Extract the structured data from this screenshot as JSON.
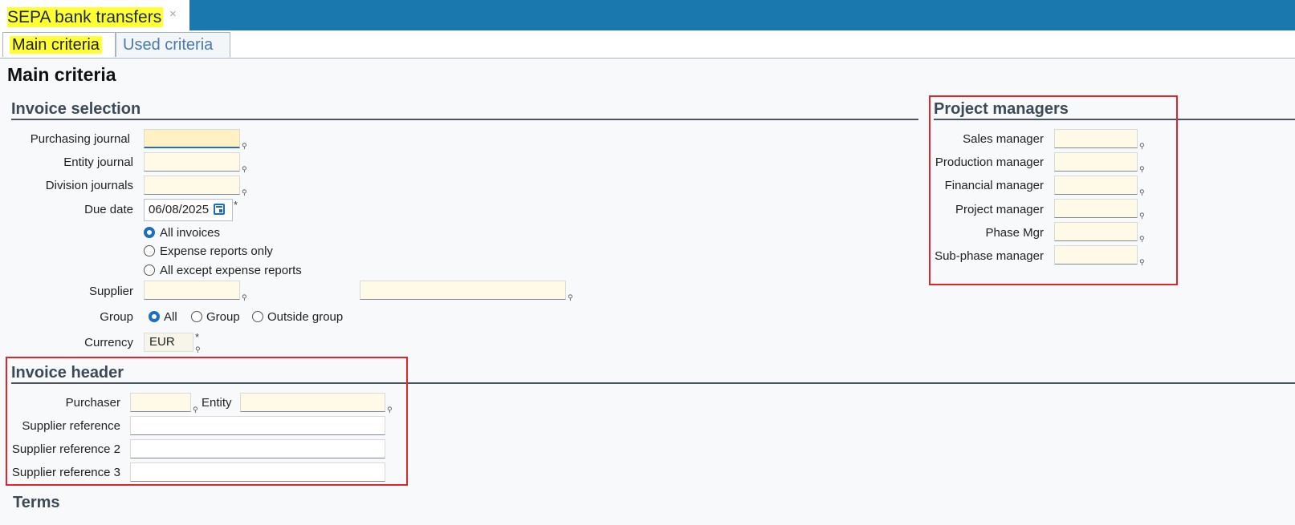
{
  "window": {
    "tab_title": "SEPA bank transfers",
    "close_glyph": "×"
  },
  "tabs": [
    {
      "label": "Main criteria",
      "active": true
    },
    {
      "label": "Used criteria",
      "active": false
    }
  ],
  "page_title": "Main criteria",
  "invoice_selection": {
    "title": "Invoice selection",
    "purchasing_journal_label": "Purchasing journal",
    "entity_journal_label": "Entity journal",
    "division_journals_label": "Division journals",
    "due_date_label": "Due date",
    "due_date_value": "06/08/2025",
    "required_mark": "*",
    "invoice_types": [
      "All invoices",
      "Expense reports only",
      "All except expense reports"
    ],
    "invoice_type_selected": "All invoices",
    "supplier_label": "Supplier",
    "group_label": "Group",
    "group_options": [
      "All",
      "Group",
      "Outside group"
    ],
    "group_selected": "All",
    "currency_label": "Currency",
    "currency_value": "EUR"
  },
  "project_managers": {
    "title": "Project managers",
    "labels": [
      "Sales manager",
      "Production manager",
      "Financial manager",
      "Project manager",
      "Phase Mgr",
      "Sub-phase manager"
    ]
  },
  "invoice_header": {
    "title": "Invoice header",
    "purchaser_label": "Purchaser",
    "entity_label": "Entity",
    "supplier_reference_label": "Supplier reference",
    "supplier_reference_2_label": "Supplier reference 2",
    "supplier_reference_3_label": "Supplier reference 3"
  },
  "terms": {
    "title": "Terms"
  },
  "icons": {
    "calendar": "calendar-icon",
    "lookup": "lookup-pin-icon"
  },
  "colors": {
    "accent": "#1b78ae",
    "highlight": "#ffff33",
    "annotation": "#e0262b",
    "radio_selected": "#1d6ec2"
  }
}
